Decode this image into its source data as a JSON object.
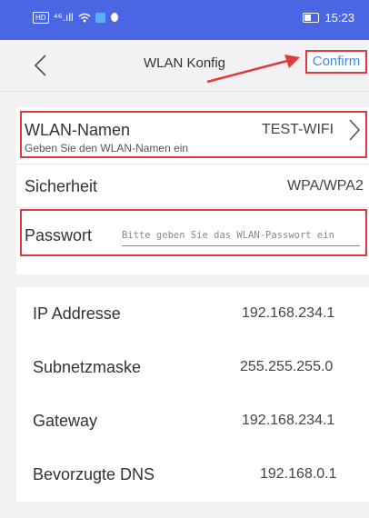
{
  "status_bar": {
    "time": "15:23",
    "hd_badge": "HD",
    "signal_text": "⁴⁶.ıll"
  },
  "header": {
    "title": "WLAN Konfig",
    "confirm_label": "Confirm"
  },
  "wifi": {
    "wlan_label": "WLAN-Namen",
    "wlan_value": "TEST-WIFI",
    "wlan_hint": "Geben Sie den WLAN-Namen ein",
    "security_label": "Sicherheit",
    "security_value": "WPA/WPA2",
    "password_label": "Passwort",
    "password_placeholder": "Bitte geben Sie das WLAN-Passwort ein"
  },
  "network": [
    {
      "label": "IP Addresse",
      "value": "192.168.234.1"
    },
    {
      "label": "Subnetzmaske",
      "value": "255.255.255.0"
    },
    {
      "label": "Gateway",
      "value": "192.168.234.1"
    },
    {
      "label": "Bevorzugte DNS",
      "value": "192.168.0.1"
    }
  ],
  "colors": {
    "status_bar": "#4a66e2",
    "highlight": "#e03a3a",
    "link": "#3b8cf0"
  },
  "icons": [
    "back-chevron-icon",
    "chevron-right-icon",
    "annotation-arrow-icon",
    "battery-icon",
    "wifi-icon"
  ]
}
